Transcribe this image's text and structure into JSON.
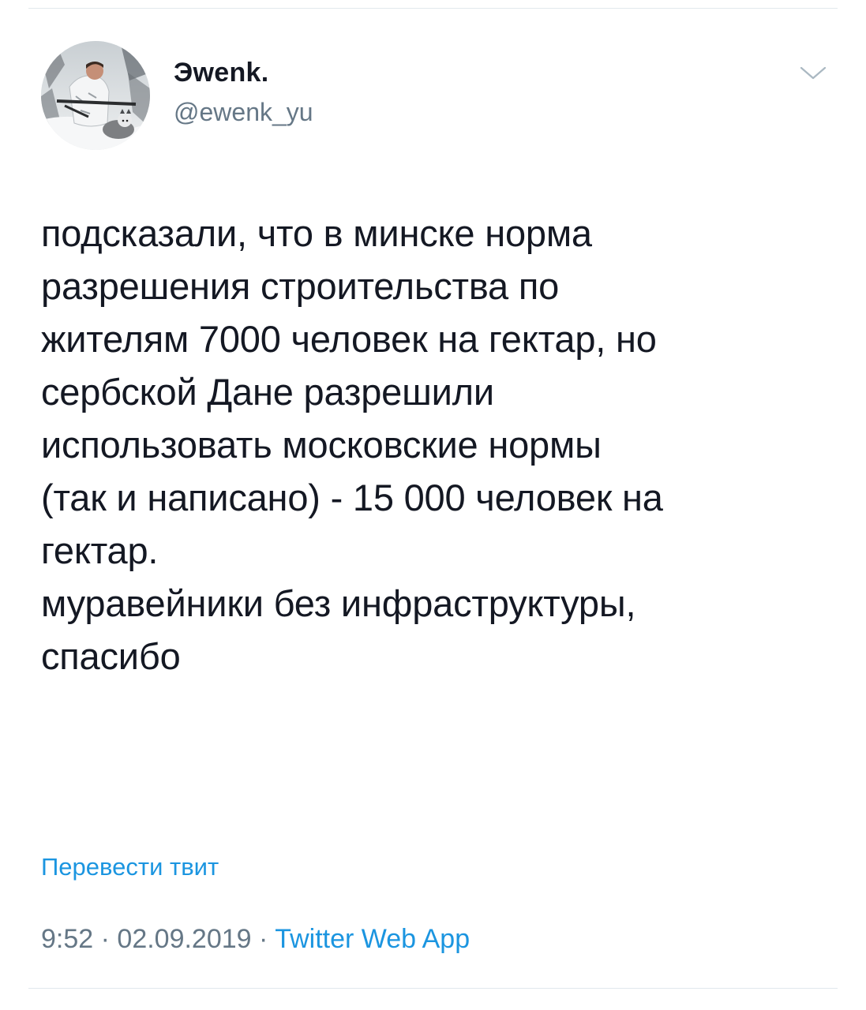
{
  "tweet": {
    "author": {
      "display_name": "Эwenk.",
      "handle": "@ewenk_yu",
      "avatar_icon": "user-avatar-photo"
    },
    "menu_icon": "chevron-down-icon",
    "text": "подсказали, что в минске норма\nразрешения строительства по\nжителям 7000 человек на гектар, но\nсербской Дане разрешили\nиспользовать московские нормы\n(так и написано) - 15 000 человек на\nгектар.\nмуравейники без инфраструктуры,\nспасибо",
    "translate_label": "Перевести твит",
    "time": "9:52",
    "separator": " · ",
    "date": "02.09.2019",
    "source": "Twitter Web App"
  },
  "colors": {
    "text": "#141823",
    "secondary": "#657786",
    "link": "#1b95e0",
    "divider": "#e1e8ed"
  }
}
